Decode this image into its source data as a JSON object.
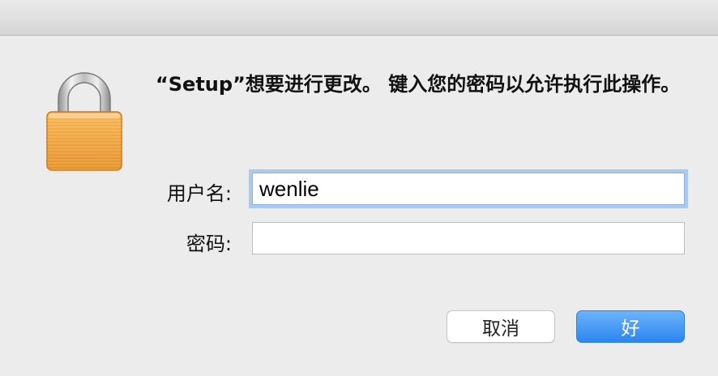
{
  "dialog": {
    "message": "“Setup”想要进行更改。 键入您的密码以允许执行此操作。",
    "username_label": "用户名:",
    "password_label": "密码:",
    "username_value": "wenlie",
    "password_value": "",
    "cancel_label": "取消",
    "ok_label": "好"
  },
  "icons": {
    "lock": "lock-icon"
  },
  "colors": {
    "accent": "#3a8ff3",
    "focus_ring": "#a9c9ef",
    "lock_body": "#f2a73b"
  }
}
